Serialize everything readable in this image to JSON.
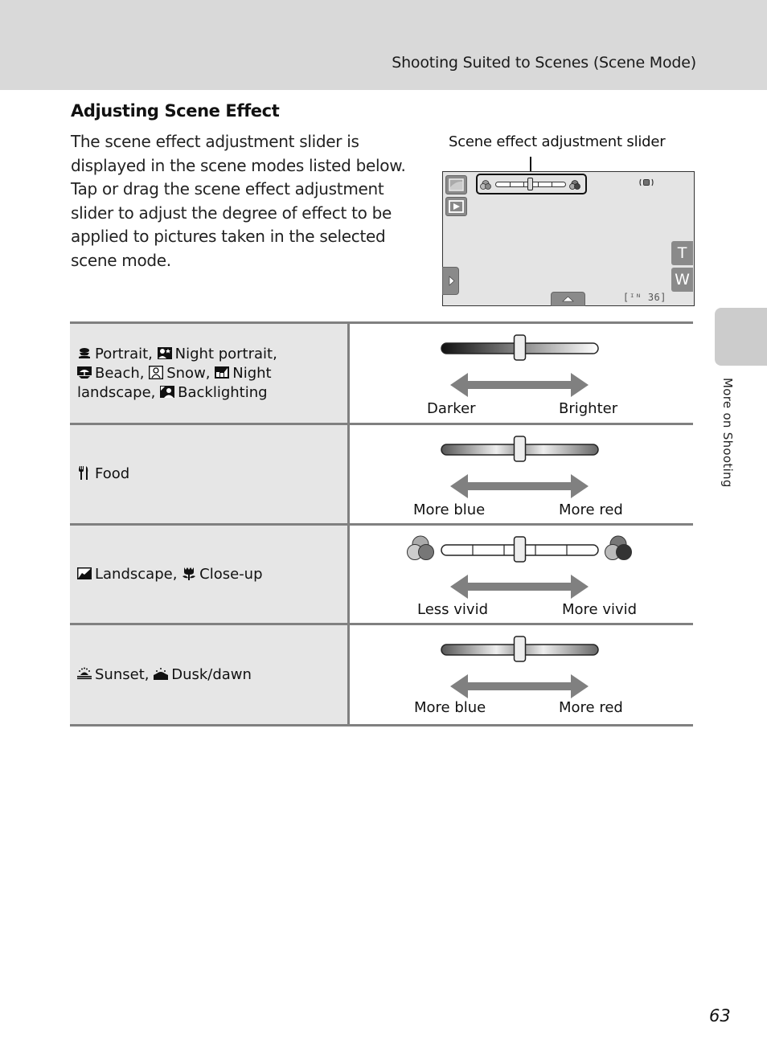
{
  "header": {
    "title": "Shooting Suited to Scenes (Scene Mode)"
  },
  "section": {
    "title": "Adjusting Scene Effect",
    "intro": "The scene effect adjustment slider is displayed in the scene modes listed below. Tap or drag the scene effect adjustment slider to adjust the degree of effect to be applied to pictures taken in the selected scene mode."
  },
  "camera_screen": {
    "callout_label": "Scene effect adjustment slider",
    "zoom_tele_label": "T",
    "zoom_wide_label": "W",
    "frame_counter": "[ᴵᴺ 36]",
    "slider_position": 0.5,
    "icons": [
      "landscape-mode-icon",
      "playback-icon",
      "vibration-reduction-icon",
      "menu-arrow-icon",
      "up-arrow-icon"
    ]
  },
  "side_tab": {
    "label": "More on Shooting"
  },
  "rows": [
    {
      "modes": [
        {
          "icon": "portrait-icon",
          "label": "Portrait,"
        },
        {
          "icon": "night-portrait-icon",
          "label": "Night portrait,"
        },
        {
          "icon": "beach-icon",
          "label": "Beach,"
        },
        {
          "icon": "snow-icon",
          "label": "Snow,"
        },
        {
          "icon": "night-landscape-icon",
          "label": "Night landscape,"
        },
        {
          "icon": "backlighting-icon",
          "label": "Backlighting"
        }
      ],
      "slider_style": "dark-to-light",
      "slider_position": 0.5,
      "left_label": "Darker",
      "right_label": "Brighter"
    },
    {
      "modes": [
        {
          "icon": "food-icon",
          "label": "Food"
        }
      ],
      "slider_style": "dark-light-dark",
      "slider_position": 0.5,
      "left_label": "More blue",
      "right_label": "More red"
    },
    {
      "modes": [
        {
          "icon": "landscape-icon",
          "label": "Landscape,"
        },
        {
          "icon": "close-up-icon",
          "label": "Close-up"
        }
      ],
      "slider_style": "ticked",
      "slider_position": 0.5,
      "left_label": "Less vivid",
      "right_label": "More vivid"
    },
    {
      "modes": [
        {
          "icon": "sunset-icon",
          "label": "Sunset,"
        },
        {
          "icon": "dusk-dawn-icon",
          "label": "Dusk/dawn"
        }
      ],
      "slider_style": "dark-light-dark",
      "slider_position": 0.5,
      "left_label": "More blue",
      "right_label": "More red"
    }
  ],
  "page_number": "63"
}
